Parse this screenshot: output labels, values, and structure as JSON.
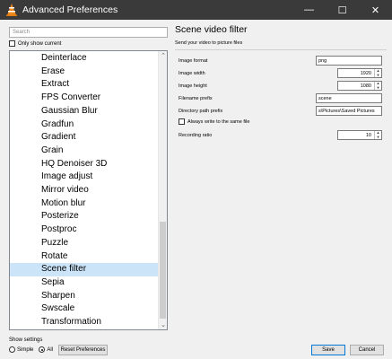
{
  "window": {
    "title": "Advanced Preferences",
    "controls": {
      "minimize": "—",
      "maximize": "☐",
      "close": "✕"
    }
  },
  "search": {
    "placeholder": "Search"
  },
  "only_show_current": {
    "label": "Only show current",
    "checked": false
  },
  "tree": {
    "items": [
      "Deinterlace",
      "Erase",
      "Extract",
      "FPS Converter",
      "Gaussian Blur",
      "Gradfun",
      "Gradient",
      "Grain",
      "HQ Denoiser 3D",
      "Image adjust",
      "Mirror video",
      "Motion blur",
      "Posterize",
      "Postproc",
      "Puzzle",
      "Rotate",
      "Scene filter",
      "Sepia",
      "Sharpen",
      "Swscale",
      "Transformation"
    ],
    "selected": "Scene filter"
  },
  "panel": {
    "title": "Scene video filter",
    "description": "Send your video to picture files",
    "options": {
      "image_format": {
        "label": "Image format",
        "value": "png"
      },
      "image_width": {
        "label": "Image width",
        "value": "1920"
      },
      "image_height": {
        "label": "Image height",
        "value": "1080"
      },
      "filename_prefix": {
        "label": "Filename prefix",
        "value": "scene"
      },
      "directory_path_prefix": {
        "label": "Directory path prefix",
        "value": "s\\Pictures\\Saved Pictures"
      },
      "always_write_same_file": {
        "label": "Always write to the same file",
        "checked": false
      },
      "recording_ratio": {
        "label": "Recording ratio",
        "value": "10"
      }
    }
  },
  "show_settings": {
    "label": "Show settings",
    "options": [
      "Simple",
      "All"
    ],
    "selected": "All"
  },
  "buttons": {
    "reset": "Reset Preferences",
    "save": "Save",
    "cancel": "Cancel"
  },
  "colors": {
    "titlebar": "#3a3a3a",
    "selection": "#cce4f7",
    "accent": "#0078d7"
  }
}
